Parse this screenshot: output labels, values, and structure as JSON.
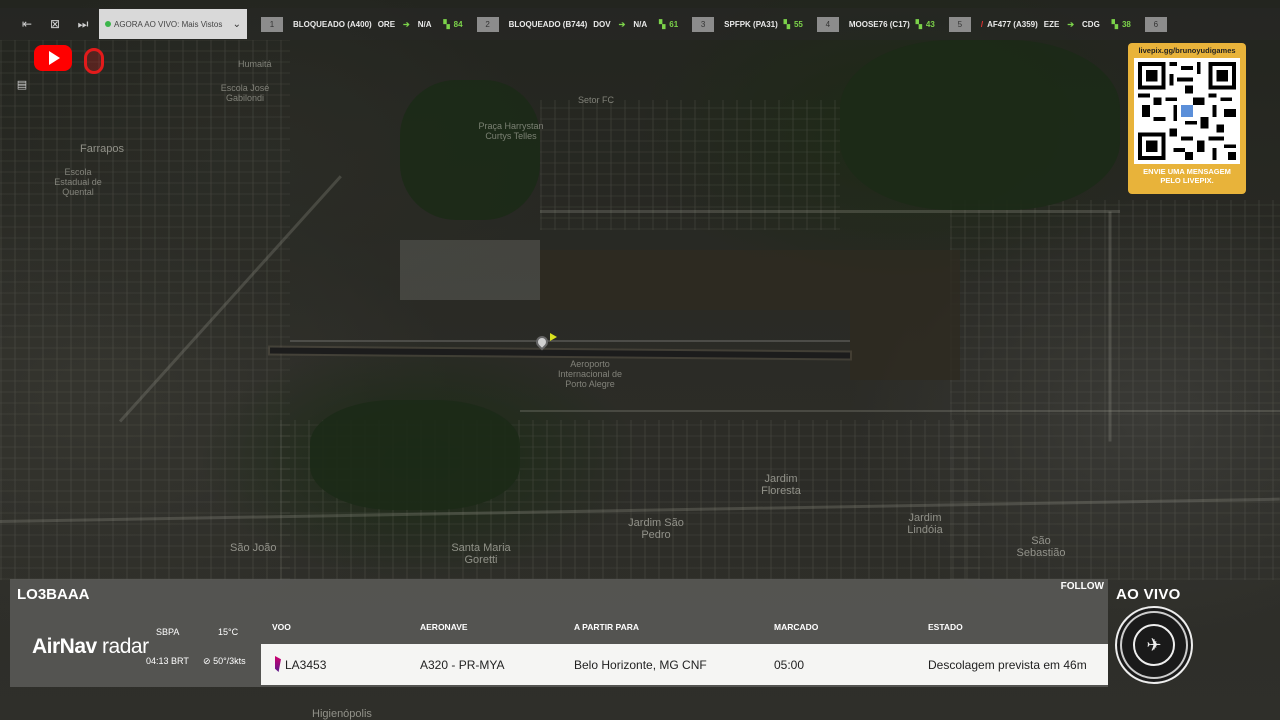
{
  "toolbar": {
    "live_select_label": "AGORA AO VIVO: Mais Vistos",
    "icons": [
      "collapse-left-icon",
      "expand-icon",
      "skip-next-icon",
      "chevron-down-icon"
    ],
    "tabs": [
      {
        "num": "1",
        "label": "BLOQUEADO (A400)",
        "origin": "ORE",
        "dest": "N/A",
        "count": "84"
      },
      {
        "num": "2",
        "label": "BLOQUEADO (B744)",
        "origin": "DOV",
        "dest": "N/A",
        "count": "61"
      },
      {
        "num": "3",
        "label": "SPFPK (PA31)",
        "origin": "",
        "dest": "",
        "count": "55"
      },
      {
        "num": "4",
        "label": "MOOSE76 (C17)",
        "origin": "",
        "dest": "",
        "count": "43"
      },
      {
        "num": "5",
        "label": "AF477 (A359)",
        "origin": "EZE",
        "dest": "CDG",
        "count": "38"
      },
      {
        "num": "6",
        "label": "",
        "origin": "",
        "dest": "",
        "count": ""
      }
    ]
  },
  "map_labels": {
    "humaita": "Humaitá",
    "farrapos": "Farrapos",
    "escola_jose": "Escola José Gabilondi",
    "escola_quental": "Escola Estadual de Quental",
    "praca": "Praça Harrystan Curtys Telles",
    "setor": "Setor FC",
    "aeroporto": "Aeroporto Internacional de Porto Alegre",
    "jardim_floresta": "Jardim Floresta",
    "jardim_sao_pedro": "Jardim São Pedro",
    "jardim_lindoia": "Jardim Lindóia",
    "sao_sebastiao": "São Sebastião",
    "santa_maria": "Santa Maria Goretti",
    "sao_joao": "São João",
    "higienopolis": "Higienópolis"
  },
  "qr": {
    "url": "livepix.gg/brunoyudigames",
    "message": "ENVIE UMA MENSAGEM PELO LIVEPIX."
  },
  "flight": {
    "callsign": "LO3BAAA",
    "follow": "FOLLOW",
    "brand_air": "AirNav",
    "brand_radar": " radar",
    "icao": "SBPA",
    "temp": "15°C",
    "local_time": "04:13 BRT",
    "wind": "50°/3kts",
    "headers": {
      "voo": "VOO",
      "aeronave": "AERONAVE",
      "destino": "A PARTIR PARA",
      "marcado": "MARCADO",
      "estado": "ESTADO"
    },
    "row": {
      "voo": "LA3453",
      "aeronave": "A320 - PR-MYA",
      "destino": "Belo Horizonte, MG CNF",
      "marcado": "05:00",
      "estado": "Descolagem prevista em 46m"
    }
  },
  "live_badge": {
    "label": "AO VIVO"
  }
}
